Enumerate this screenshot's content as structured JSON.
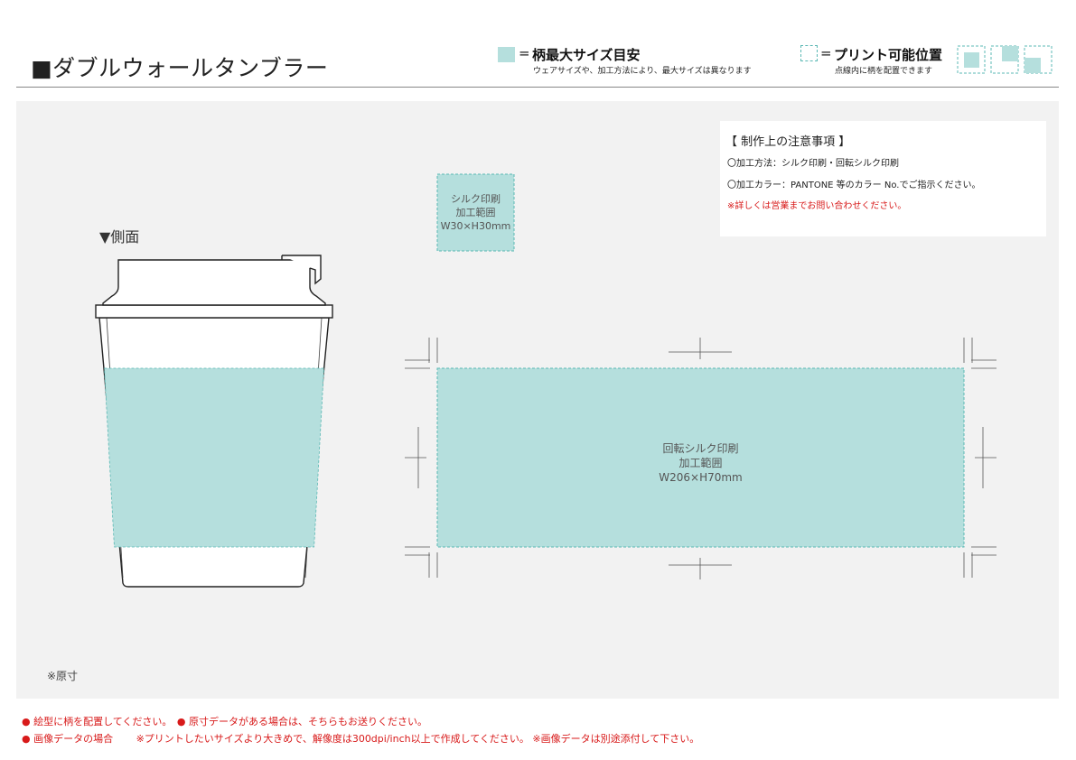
{
  "header": {
    "title": "■ダブルウォールタンブラー",
    "legend_area": {
      "equals": "=",
      "label": "柄最大サイズ目安",
      "note": "ウェアサイズや、加工方法により、最大サイズは異なります",
      "swatch_color": "#b5dfdd"
    },
    "legend_position": {
      "equals": "=",
      "label": "プリント可能位置",
      "note": "点線内に柄を配置できます"
    }
  },
  "notes": {
    "heading": "【 制作上の注意事項 】",
    "items": [
      "〇加工方法：シルク印刷・回転シルク印刷",
      "〇加工カラー：PANTONE 等のカラー No.でご指示ください。",
      "※詳しくは営業までお問い合わせください。"
    ]
  },
  "side_view": {
    "label": "▼側面",
    "print_band_color": "#b5dfdd"
  },
  "print_areas": {
    "silk": {
      "line1": "シルク印刷",
      "line2": "加工範囲",
      "size": "W30×H30mm"
    },
    "rotary": {
      "line1": "回転シルク印刷",
      "line2": "加工範囲",
      "size": "W206×H70mm"
    }
  },
  "scale_note": "※原寸",
  "footer": {
    "line1": "● 絵型に柄を配置してください。　● 原寸データがある場合は、そちらもお送りください。",
    "line2": "● 画像データの場合　　 ※プリントしたいサイズより大きめで、解像度は300dpi/inch以上で作成してください。 ※画像データは別途添付して下さい。"
  }
}
